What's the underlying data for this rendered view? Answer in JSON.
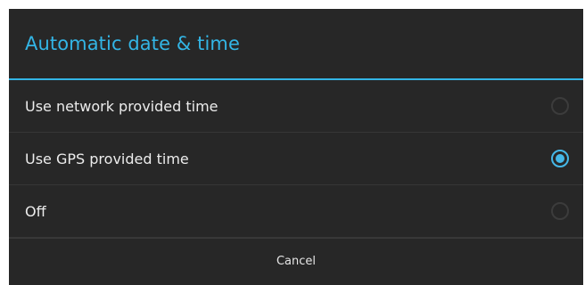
{
  "dialog": {
    "title": "Automatic date & time",
    "accent_color": "#33b5e5",
    "options": [
      {
        "label": "Use network provided time",
        "selected": false
      },
      {
        "label": "Use GPS provided time",
        "selected": true
      },
      {
        "label": "Off",
        "selected": false
      }
    ],
    "cancel_label": "Cancel"
  }
}
